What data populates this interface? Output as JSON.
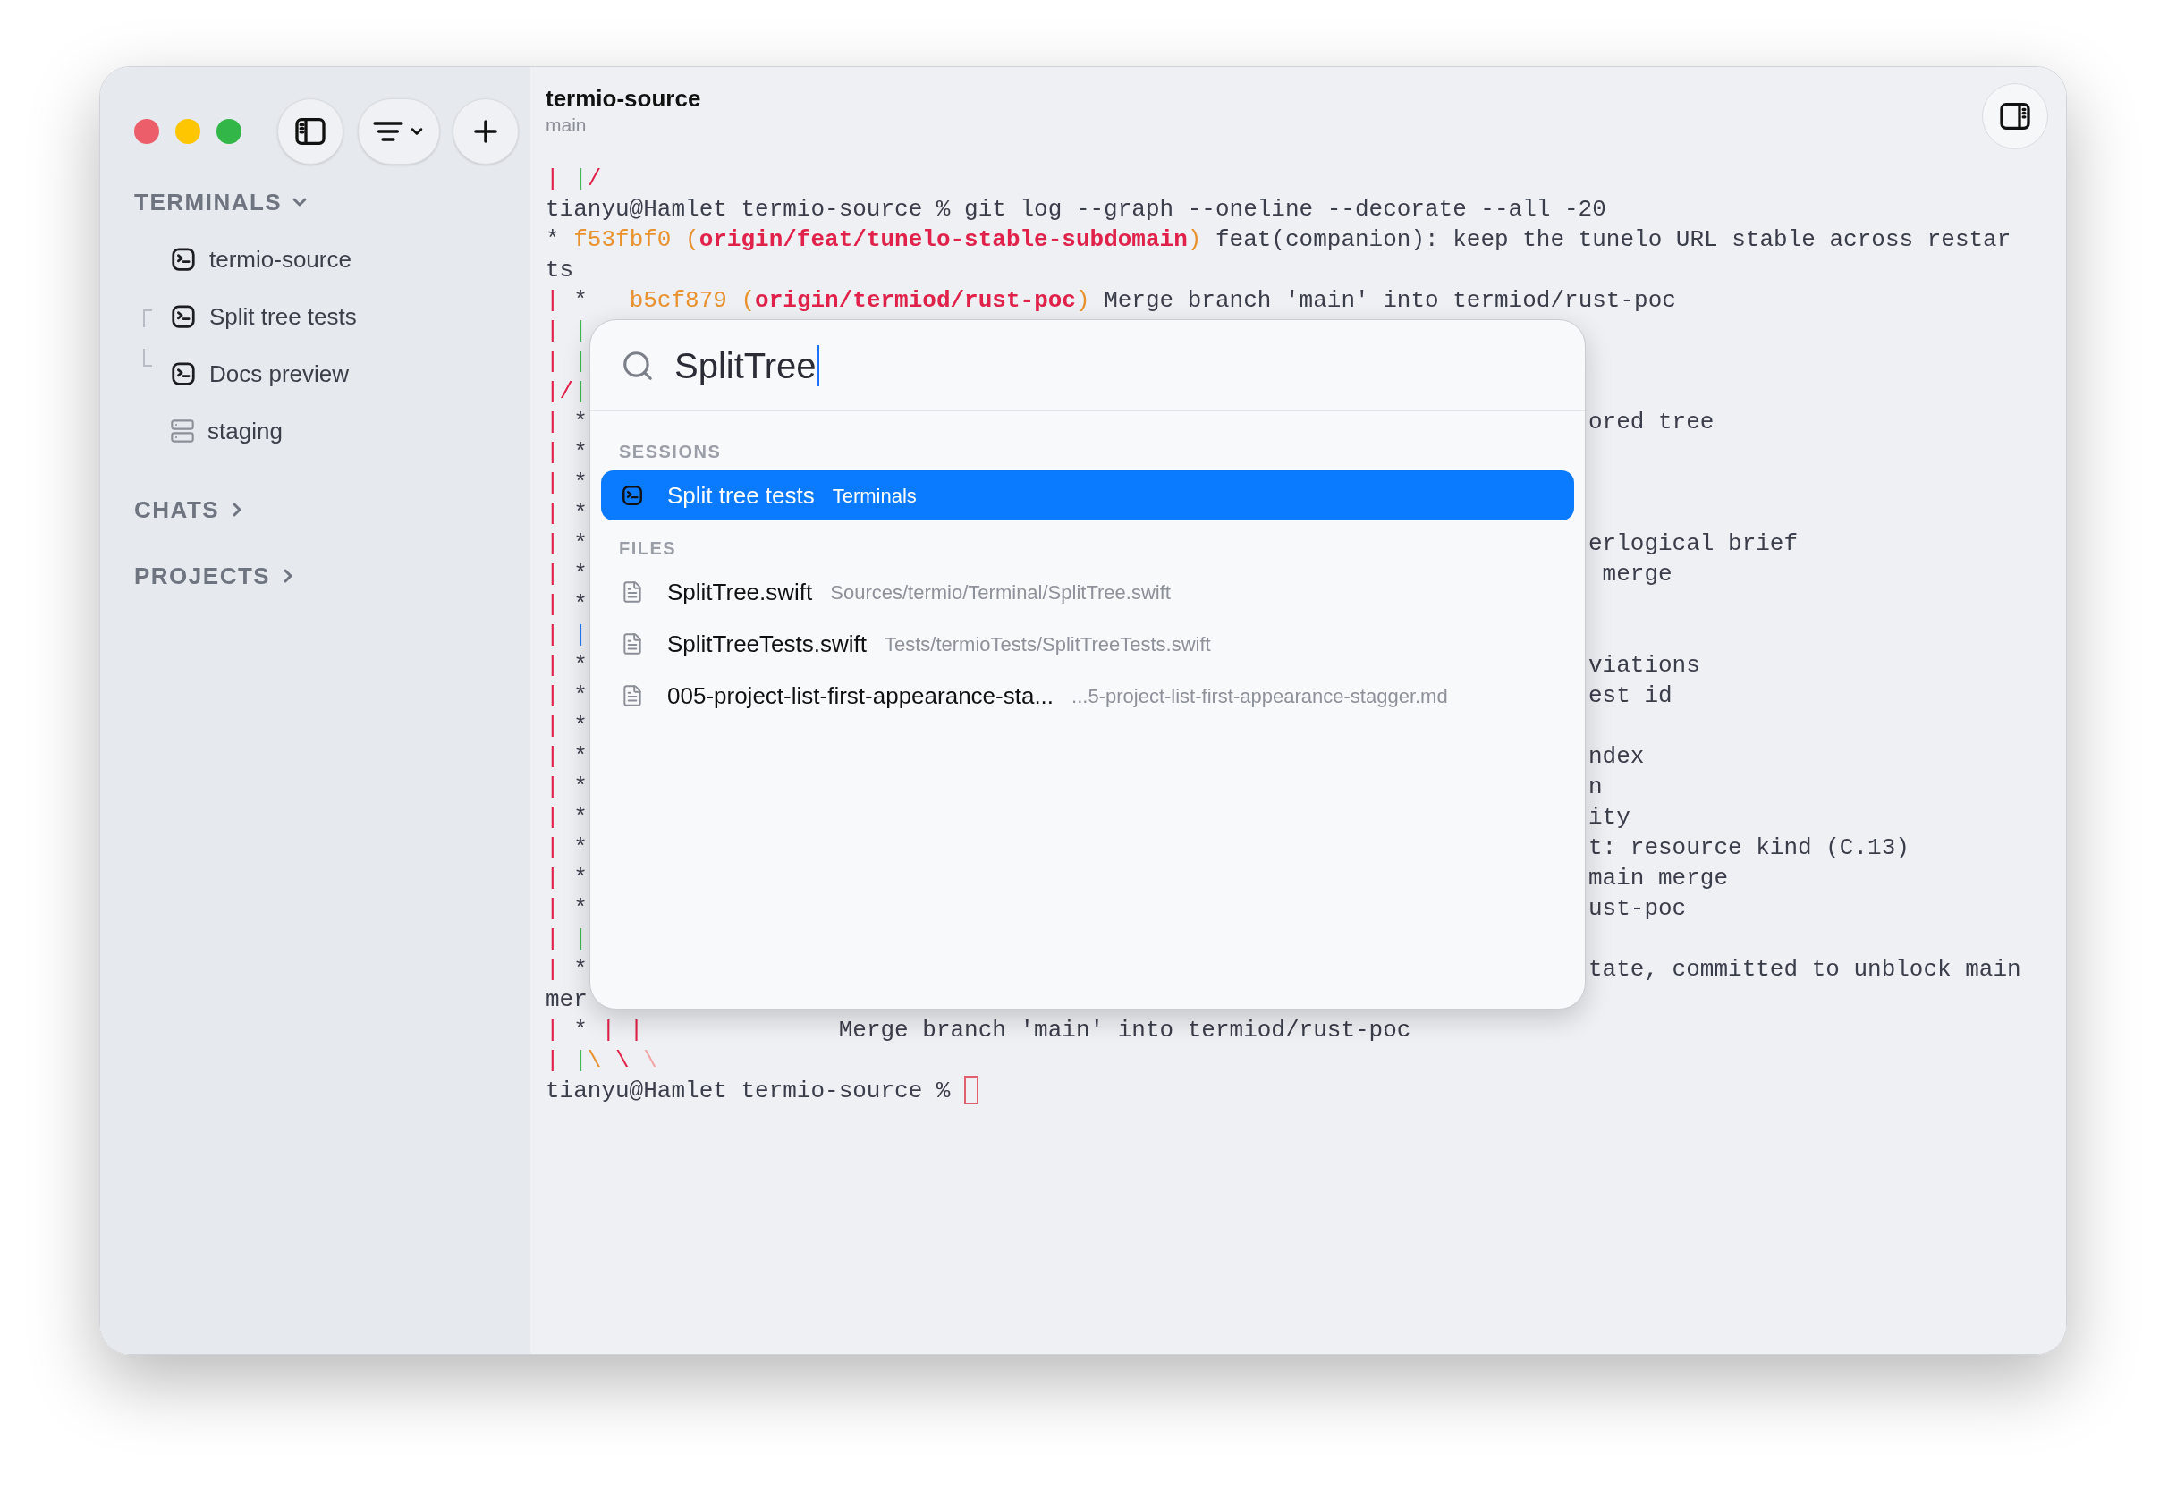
{
  "sidebar": {
    "sections": [
      {
        "label": "TERMINALS",
        "expanded": true,
        "items": [
          {
            "label": "termio-source",
            "kind": "terminal"
          },
          {
            "label": "Split tree tests",
            "kind": "terminal",
            "split": true
          },
          {
            "label": "Docs preview",
            "kind": "terminal",
            "split": true
          },
          {
            "label": "staging",
            "kind": "server"
          }
        ]
      },
      {
        "label": "CHATS",
        "expanded": false
      },
      {
        "label": "PROJECTS",
        "expanded": false
      }
    ]
  },
  "header": {
    "title": "termio-source",
    "subtitle": "main"
  },
  "terminal": {
    "lines": [
      {
        "segments": [
          {
            "text": "| ",
            "color": "#e0224a"
          },
          {
            "text": "|",
            "color": "#3fb950"
          },
          {
            "text": "/",
            "color": "#e0224a"
          }
        ]
      },
      {
        "segments": [
          {
            "text": "tianyu@Hamlet termio-source % git log --graph --oneline --decorate --all -20",
            "color": "#3a3d4a"
          }
        ]
      },
      {
        "segments": [
          {
            "text": "* ",
            "color": "#3a3d4a"
          },
          {
            "text": "f53fbf0 (",
            "color": "#e8912d"
          },
          {
            "text": "origin/feat/tunelo-stable-subdomain",
            "color": "#e0224a",
            "bold": true
          },
          {
            "text": ")",
            "color": "#e8912d"
          },
          {
            "text": " feat(companion): keep the tunelo URL stable across restar",
            "color": "#3a3d4a"
          }
        ]
      },
      {
        "segments": [
          {
            "text": "ts",
            "color": "#3a3d4a"
          }
        ]
      },
      {
        "segments": [
          {
            "text": "| ",
            "color": "#e0224a"
          },
          {
            "text": "*   ",
            "color": "#3a3d4a"
          },
          {
            "text": "b5cf879 (",
            "color": "#e8912d"
          },
          {
            "text": "origin/termiod/rust-poc",
            "color": "#e0224a",
            "bold": true
          },
          {
            "text": ")",
            "color": "#e8912d"
          },
          {
            "text": " Merge branch 'main' into termiod/rust-poc",
            "color": "#3a3d4a"
          }
        ]
      },
      {
        "segments": [
          {
            "text": "| ",
            "color": "#e0224a"
          },
          {
            "text": "|",
            "color": "#3fb950"
          }
        ]
      },
      {
        "segments": [
          {
            "text": "| ",
            "color": "#e0224a"
          },
          {
            "text": "|",
            "color": "#3fb950"
          }
        ]
      },
      {
        "segments": [
          {
            "text": "|/",
            "color": "#e0224a"
          },
          {
            "text": "|",
            "color": "#3fb950"
          }
        ]
      },
      {
        "segments": [
          {
            "text": "| ",
            "color": "#e0224a"
          },
          {
            "text": "*",
            "color": "#3a3d4a"
          }
        ],
        "right": "ored tree"
      },
      {
        "segments": [
          {
            "text": "| ",
            "color": "#e0224a"
          },
          {
            "text": "*",
            "color": "#3a3d4a"
          }
        ]
      },
      {
        "segments": [
          {
            "text": "| ",
            "color": "#e0224a"
          },
          {
            "text": "*",
            "color": "#3a3d4a"
          }
        ]
      },
      {
        "segments": [
          {
            "text": "| ",
            "color": "#e0224a"
          },
          {
            "text": "*",
            "color": "#3a3d4a"
          }
        ]
      },
      {
        "segments": [
          {
            "text": "| ",
            "color": "#e0224a"
          },
          {
            "text": "*",
            "color": "#3a3d4a"
          }
        ],
        "right": "erlogical brief"
      },
      {
        "segments": [
          {
            "text": "| ",
            "color": "#e0224a"
          },
          {
            "text": "*",
            "color": "#3a3d4a"
          }
        ],
        "right": " merge"
      },
      {
        "segments": [
          {
            "text": "| ",
            "color": "#e0224a"
          },
          {
            "text": "*",
            "color": "#3a3d4a"
          }
        ]
      },
      {
        "segments": [
          {
            "text": "| ",
            "color": "#e0224a"
          },
          {
            "text": "|",
            "color": "#1f7aff"
          }
        ]
      },
      {
        "segments": [
          {
            "text": "| ",
            "color": "#e0224a"
          },
          {
            "text": "*",
            "color": "#3a3d4a"
          }
        ],
        "right": "viations"
      },
      {
        "segments": [
          {
            "text": "| ",
            "color": "#e0224a"
          },
          {
            "text": "*",
            "color": "#3a3d4a"
          }
        ],
        "right": "est id"
      },
      {
        "segments": [
          {
            "text": "| ",
            "color": "#e0224a"
          },
          {
            "text": "*",
            "color": "#3a3d4a"
          }
        ]
      },
      {
        "segments": [
          {
            "text": "| ",
            "color": "#e0224a"
          },
          {
            "text": "*",
            "color": "#3a3d4a"
          }
        ],
        "right": "ndex"
      },
      {
        "segments": [
          {
            "text": "| ",
            "color": "#e0224a"
          },
          {
            "text": "*",
            "color": "#3a3d4a"
          }
        ],
        "right": "n"
      },
      {
        "segments": [
          {
            "text": "| ",
            "color": "#e0224a"
          },
          {
            "text": "*",
            "color": "#3a3d4a"
          }
        ],
        "right": "ity"
      },
      {
        "segments": [
          {
            "text": "| ",
            "color": "#e0224a"
          },
          {
            "text": "*",
            "color": "#3a3d4a"
          }
        ],
        "right": "t: resource kind (C.13)"
      },
      {
        "segments": [
          {
            "text": "| ",
            "color": "#e0224a"
          },
          {
            "text": "*",
            "color": "#3a3d4a"
          }
        ],
        "right": "main merge"
      },
      {
        "segments": [
          {
            "text": "| ",
            "color": "#e0224a"
          },
          {
            "text": "*",
            "color": "#3a3d4a"
          }
        ],
        "right": "ust-poc"
      },
      {
        "segments": [
          {
            "text": "| ",
            "color": "#e0224a"
          },
          {
            "text": "|",
            "color": "#3fb950"
          }
        ]
      },
      {
        "segments": [
          {
            "text": "| ",
            "color": "#e0224a"
          },
          {
            "text": "*",
            "color": "#3a3d4a"
          }
        ],
        "right": "tate, committed to unblock main"
      },
      {
        "segments": [
          {
            "text": "mer",
            "color": "#3a3d4a"
          }
        ]
      },
      {
        "segments": [
          {
            "text": "| ",
            "color": "#e0224a"
          },
          {
            "text": "* ",
            "color": "#3a3d4a"
          },
          {
            "text": "| |",
            "color": "#e0224a"
          },
          {
            "text": "              Merge branch 'main' into termiod/rust-poc",
            "color": "#3a3d4a"
          }
        ]
      },
      {
        "segments": [
          {
            "text": "| ",
            "color": "#e0224a"
          },
          {
            "text": "|",
            "color": "#3fb950"
          },
          {
            "text": "\\",
            "color": "#e8912d"
          },
          {
            "text": " \\ ",
            "color": "#e0224a"
          },
          {
            "text": "\\",
            "color": "#f2a5a5"
          }
        ]
      },
      {
        "segments": [
          {
            "text": "tianyu@Hamlet termio-source % ",
            "color": "#3a3d4a"
          }
        ],
        "cursor": true
      }
    ]
  },
  "palette": {
    "query": "SplitTree",
    "groups": [
      {
        "label": "SESSIONS",
        "items": [
          {
            "kind": "session",
            "title": "Split tree tests",
            "detail": "Terminals",
            "selected": true
          }
        ]
      },
      {
        "label": "FILES",
        "items": [
          {
            "kind": "file",
            "title": "SplitTree.swift",
            "detail": "Sources/termio/Terminal/SplitTree.swift",
            "selected": false
          },
          {
            "kind": "file",
            "title": "SplitTreeTests.swift",
            "detail": "Tests/termioTests/SplitTreeTests.swift",
            "selected": false
          },
          {
            "kind": "file",
            "title": "005-project-list-first-appearance-sta...",
            "detail": "...5-project-list-first-appearance-stagger.md",
            "selected": false
          }
        ]
      }
    ]
  }
}
